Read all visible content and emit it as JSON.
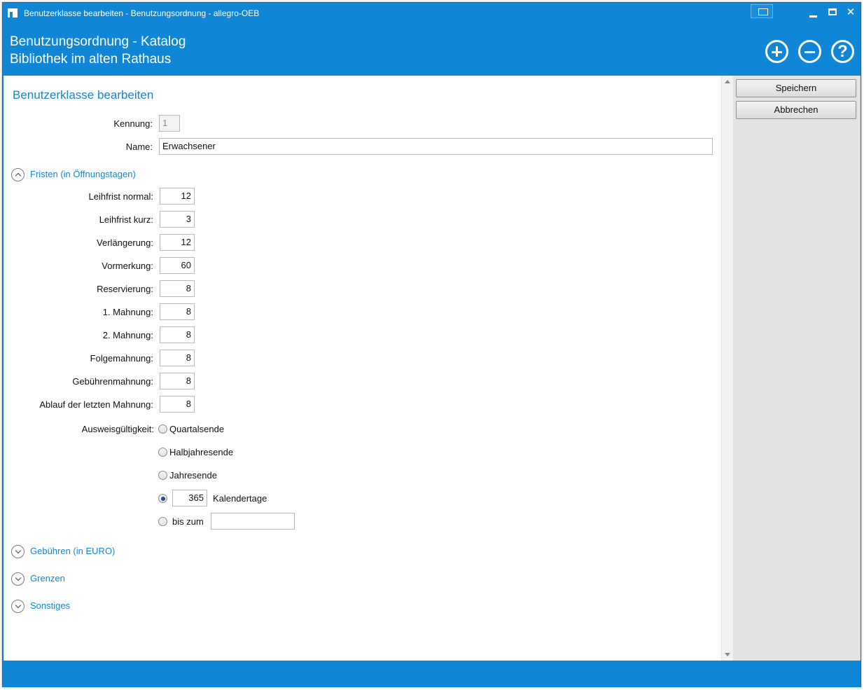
{
  "window": {
    "title": "Benutzerklasse bearbeiten - Benutzungsordnung - allegro-OEB",
    "close_symbol": "✕"
  },
  "header": {
    "title_line1": "Benutzungsordnung - Katalog",
    "title_line2": "Bibliothek im alten Rathaus",
    "help_symbol": "?"
  },
  "actions": {
    "save_label": "Speichern",
    "cancel_label": "Abbrechen"
  },
  "form": {
    "title": "Benutzerklasse bearbeiten",
    "kennung_label": "Kennung:",
    "kennung_value": "1",
    "name_label": "Name:",
    "name_value": "Erwachsener"
  },
  "fristen": {
    "section_label": "Fristen (in Öffnungstagen)",
    "expanded": true,
    "fields": [
      {
        "label": "Leihfrist normal:",
        "value": "12"
      },
      {
        "label": "Leihfrist kurz:",
        "value": "3"
      },
      {
        "label": "Verlängerung:",
        "value": "12"
      },
      {
        "label": "Vormerkung:",
        "value": "60"
      },
      {
        "label": "Reservierung:",
        "value": "8"
      },
      {
        "label": "1. Mahnung:",
        "value": "8"
      },
      {
        "label": "2. Mahnung:",
        "value": "8"
      },
      {
        "label": "Folgemahnung:",
        "value": "8"
      },
      {
        "label": "Gebührenmahnung:",
        "value": "8"
      },
      {
        "label": "Ablauf der letzten Mahnung:",
        "value": "8"
      }
    ],
    "validity": {
      "label": "Ausweisgültigkeit:",
      "options": [
        {
          "label": "Quartalsende",
          "checked": false
        },
        {
          "label": "Halbjahresende",
          "checked": false
        },
        {
          "label": "Jahresende",
          "checked": false
        },
        {
          "label": "Kalendertage",
          "checked": true,
          "value": "365"
        },
        {
          "label": "bis zum",
          "checked": false,
          "value": ""
        }
      ]
    }
  },
  "sections": [
    {
      "label": "Gebühren (in EURO)",
      "expanded": false
    },
    {
      "label": "Grenzen",
      "expanded": false
    },
    {
      "label": "Sonstiges",
      "expanded": false
    }
  ],
  "colors": {
    "accent": "#0f86d6",
    "link": "#1a86c9"
  }
}
